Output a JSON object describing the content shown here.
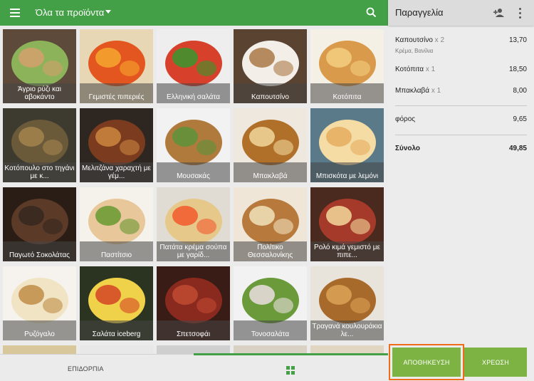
{
  "header": {
    "category": "Όλα τα προϊόντα"
  },
  "products": [
    {
      "name": "Άγριο ρύζι και αβοκάντο",
      "icon": "wild-rice-avocado-photo"
    },
    {
      "name": "Γεμιστές πιπεριές",
      "icon": "stuffed-peppers-photo"
    },
    {
      "name": "Ελληνική σαλάτα",
      "icon": "greek-salad-photo"
    },
    {
      "name": "Καπουτσίνο",
      "icon": "cappuccino-photo"
    },
    {
      "name": "Κοτόπιτα",
      "icon": "chicken-pie-photo"
    },
    {
      "name": "Κοτόπουλο στο τηγάνι με κ...",
      "icon": "pan-chicken-photo"
    },
    {
      "name": "Μελιτζάνα χαραχτή με γέμ...",
      "icon": "stuffed-eggplant-photo"
    },
    {
      "name": "Μουσακάς",
      "icon": "moussaka-photo"
    },
    {
      "name": "Μπακλαβά",
      "icon": "baklava-photo"
    },
    {
      "name": "Μπισκότα με λεμόνι",
      "icon": "lemon-cookies-photo"
    },
    {
      "name": "Παγωτό Σοκολάτας",
      "icon": "chocolate-icecream-photo"
    },
    {
      "name": "Παστίτσιο",
      "icon": "pastitsio-photo"
    },
    {
      "name": "Πατάτα κρέμα σούπα με γαρίδ...",
      "icon": "potato-soup-photo"
    },
    {
      "name": "Πολίτικο Θεσσαλονίκης",
      "icon": "politiko-cake-photo"
    },
    {
      "name": "Ρολό κιμά γεμιστό με πιπε...",
      "icon": "meatloaf-photo"
    },
    {
      "name": "Ρυζόγαλο",
      "icon": "rice-pudding-photo"
    },
    {
      "name": "Σαλάτα iceberg",
      "icon": "iceberg-salad-photo"
    },
    {
      "name": "Σπετσοφάι",
      "icon": "spetsofai-photo"
    },
    {
      "name": "Τονοσαλάτα",
      "icon": "tuna-salad-photo"
    },
    {
      "name": "Τραγανά κουλουράκια λε...",
      "icon": "crunchy-cookies-photo"
    }
  ],
  "bottom_tabs": {
    "desserts": "ΕΠΙΔΟΡΠΙΑ"
  },
  "order": {
    "title": "Παραγγελία",
    "lines": [
      {
        "name": "Καπουτσίνο",
        "qty": "x 2",
        "amount": "13,70",
        "modifiers": "Κρέμα, Βανίλια"
      },
      {
        "name": "Κοτόπιτα",
        "qty": "x 1",
        "amount": "18,50"
      },
      {
        "name": "Μπακλαβά",
        "qty": "x 1",
        "amount": "8,00"
      }
    ],
    "tax_label": "φόρος",
    "tax_amount": "9,65",
    "total_label": "Σύνολο",
    "total_amount": "49,85"
  },
  "actions": {
    "save": "ΑΠΟΘΗΚΕΥΣΗ",
    "charge": "ΧΡΕΩΣΗ"
  },
  "colors": {
    "primary_green": "#43a047",
    "button_green": "#7cb342",
    "highlight_orange": "#ef6c1a"
  }
}
